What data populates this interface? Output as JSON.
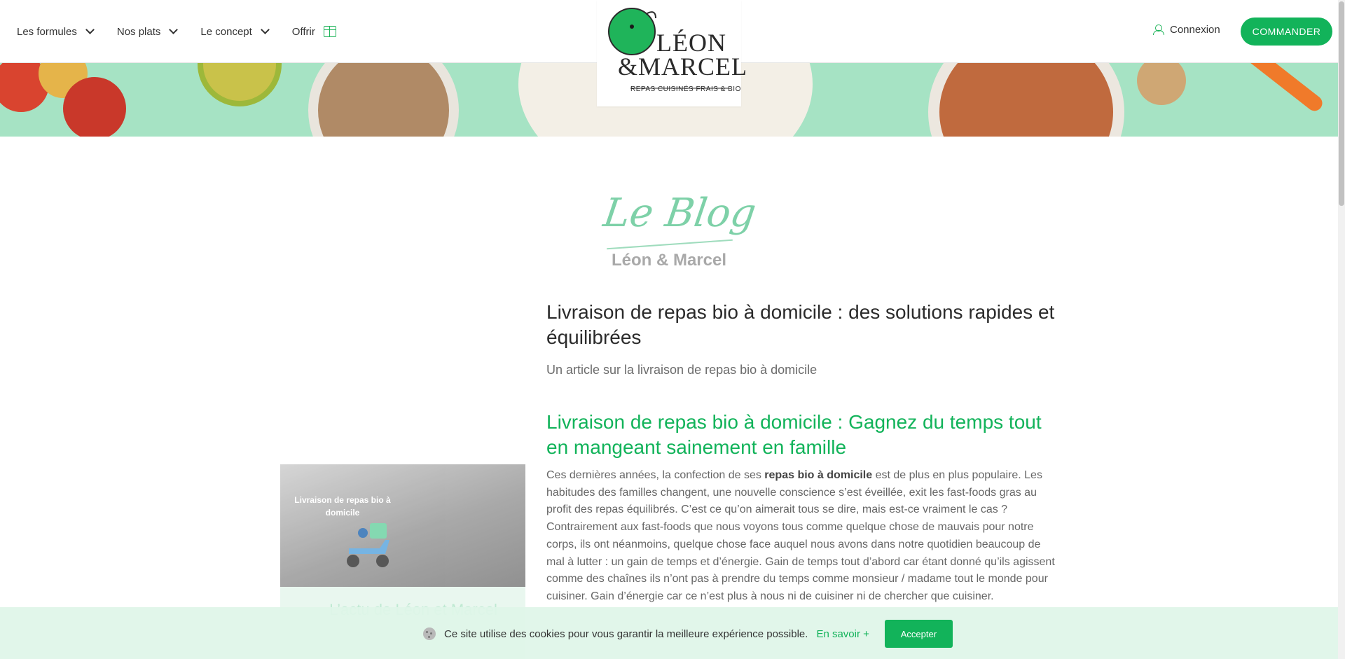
{
  "header": {
    "nav": [
      {
        "label": "Les formules",
        "icon": "chevron-down-icon"
      },
      {
        "label": "Nos plats",
        "icon": "chevron-down-icon"
      },
      {
        "label": "Le concept",
        "icon": "chevron-down-icon"
      },
      {
        "label": "Offrir",
        "icon": "gift-icon"
      }
    ],
    "logo": {
      "line1": "LÉON",
      "line2": "&MARCEL",
      "tagline": "REPAS CUISINÉS FRAIS & BIO"
    },
    "login_label": "Connexion",
    "order_label": "COMMANDER"
  },
  "blog": {
    "script_title": "Le Blog",
    "subtitle": "Léon & Marcel"
  },
  "article": {
    "title": "Livraison de repas bio à domicile : des solutions rapides et équilibrées",
    "subtitle": "Un article sur la livraison de repas bio à domicile",
    "heading": "Livraison de repas bio à domicile : Gagnez du temps tout en mangeant sainement en famille",
    "body_start": "Ces dernières années, la confection de ses ",
    "body_bold": "repas bio à domicile",
    "body_rest": " est de plus en plus populaire. Les habitudes des familles changent, une nouvelle conscience s’est éveillée, exit les fast-foods gras au profit des repas équilibrés. C’est ce qu’on aimerait tous se dire, mais est-ce vraiment le cas ? Contrairement aux fast-foods que nous voyons tous comme quelque chose de mauvais pour notre corps, ils ont néanmoins, quelque chose face auquel nous avons dans notre quotidien beaucoup de mal à lutter : un gain de temps et d’énergie. Gain de temps tout d’abord car étant donné qu’ils agissent comme des chaînes ils n’ont pas à prendre du temps comme monsieur / madame tout le monde pour cuisiner. Gain d’énergie car ce n’est plus à nous ni de cuisiner ni de chercher que cuisiner."
  },
  "sidebar": {
    "image_label": "Livraison de repas bio à domicile",
    "band_title": "L’actu de Léon et Marcel"
  },
  "cookie": {
    "text": "Ce site utilise des cookies pour vous garantir la meilleure expérience possible.",
    "link": "En savoir +",
    "accept": "Accepter"
  },
  "colors": {
    "accent": "#12b35a",
    "banner": "#a6e3c4"
  }
}
